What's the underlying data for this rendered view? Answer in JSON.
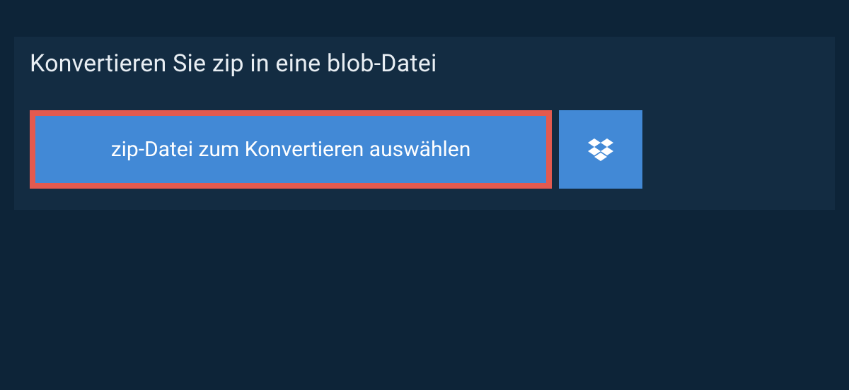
{
  "header": {
    "title": "Konvertieren Sie zip in eine blob-Datei"
  },
  "actions": {
    "select_file_label": "zip-Datei zum Konvertieren auswählen",
    "dropbox_icon": "dropbox-icon"
  }
}
